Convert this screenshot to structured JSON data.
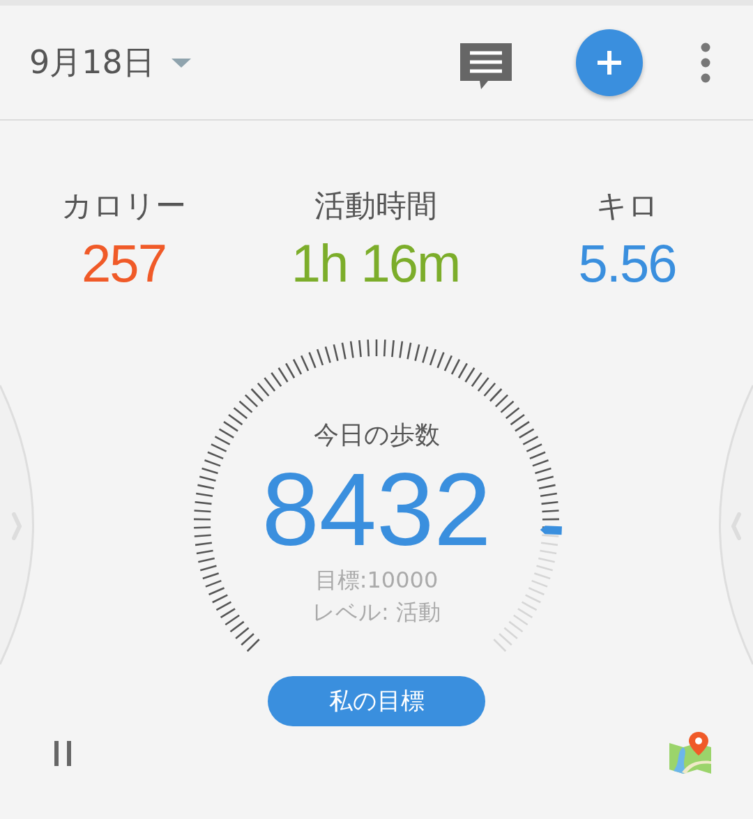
{
  "header": {
    "date": "9月18日"
  },
  "stats": [
    {
      "label": "カロリー",
      "value": "257",
      "color": "#f05a28"
    },
    {
      "label": "活動時間",
      "value": "1h 16m",
      "color": "#7cad2a"
    },
    {
      "label": "キロ",
      "value": "5.56",
      "color": "#3a8fde"
    }
  ],
  "gauge": {
    "title": "今日の歩数",
    "steps": "8432",
    "goal": "目標:10000",
    "activity": "レベル: 活動"
  },
  "goal_button": {
    "label": "私の目標"
  }
}
